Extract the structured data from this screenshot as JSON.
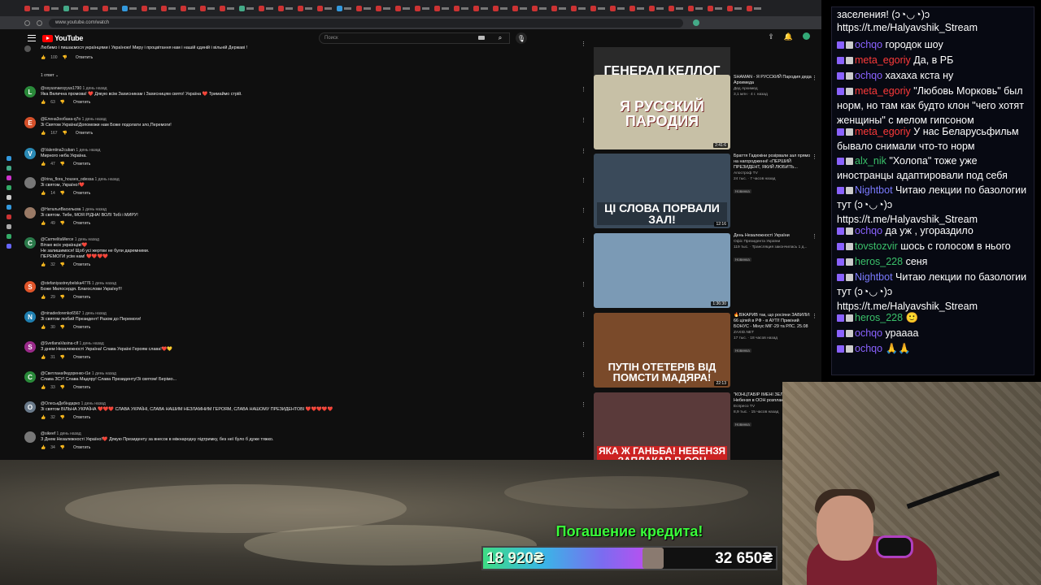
{
  "browser": {
    "url": "www.youtube.com/watch",
    "tab_colors": [
      "#c33",
      "#c33",
      "#4a8",
      "#c33",
      "#c33",
      "#39d",
      "#c33",
      "#c33",
      "#c33",
      "#c33",
      "#c33",
      "#4a8",
      "#c33",
      "#c33",
      "#c33",
      "#c33",
      "#39d",
      "#c33",
      "#c33",
      "#c33",
      "#c33",
      "#c33",
      "#c33",
      "#c33",
      "#c33",
      "#c33",
      "#c33",
      "#c33",
      "#c33",
      "#c33",
      "#c33",
      "#c33",
      "#c33",
      "#c33",
      "#c33",
      "#c33",
      "#c33",
      "#c33"
    ]
  },
  "youtube": {
    "logo": "YouTube",
    "search_placeholder": "Поиск"
  },
  "comments": [
    {
      "avatar": "",
      "avatar_color": "#555",
      "author": "",
      "time": "",
      "text": "Любимо і пишаємося українцями і Україною! Миру і процвітання нам і нашій єдиній і вільній Державі !",
      "likes": "100",
      "reply": "Ответить",
      "replies": "1 ответ"
    },
    {
      "avatar": "L",
      "avatar_color": "#2a8a3a",
      "author": "@ssyusnaesyyus1790",
      "time": "1 день назад",
      "text": "Яка Велична промова! ❤️ Дякую всім Захисникам і Захисницям свято! Україна ❤️ Тримаймо стрій.",
      "likes": "63",
      "reply": "Ответить"
    },
    {
      "avatar": "E",
      "avatar_color": "#d5502a",
      "author": "@Елена3ooбaнa-q7o",
      "time": "1 день назад",
      "text": "Зі Святом Україна!Допоможи нам Боже подолати зло,Перемоги!",
      "likes": "167",
      "reply": "Ответить"
    },
    {
      "avatar": "V",
      "avatar_color": "#2a8ab5",
      "author": "@Valentina2cuban",
      "time": "1 день назад",
      "text": "Мирного неба Україна.",
      "likes": "47",
      "reply": "Ответить"
    },
    {
      "avatar": "",
      "avatar_color": "#777",
      "author": "@Irina_flora_houses_odessa",
      "time": "1 день назад",
      "text": "Зі святом, Україно!❤️",
      "likes": "14",
      "reply": "Ответить"
    },
    {
      "avatar": "",
      "avatar_color": "#9a7a66",
      "author": "@НатальяВасильєва",
      "time": "1 день назад",
      "text": "Зі святом. Тебе, МОЯ РІДНА! ВОЛІ Тобі і МИРУ!",
      "likes": "49",
      "reply": "Ответить"
    },
    {
      "avatar": "C",
      "avatar_color": "#2a7a4a",
      "author": "@CarmelitaMerce",
      "time": "1 день назад",
      "text": "Вітаю всіх українців!❤️\nНе залишимося! Щоб усі жертви не були даремними.\nПЕРЕМОГИ усім нам! ❤️❤️❤️❤️",
      "likes": "32",
      "reply": "Ответить"
    },
    {
      "avatar": "S",
      "avatar_color": "#e0552a",
      "author": "@stefaniyastreybelska4776",
      "time": "1 день назад",
      "text": "Боже Милосердя. Благослови Україну!!!",
      "likes": "29",
      "reply": "Ответить"
    },
    {
      "avatar": "N",
      "avatar_color": "#1f7fb0",
      "author": "@ninadedorenko6567",
      "time": "1 день назад",
      "text": "Зі святом любий Президент! Разом до Перемоги!",
      "likes": "30",
      "reply": "Ответить"
    },
    {
      "avatar": "S",
      "avatar_color": "#9a2a8a",
      "author": "@SvetlanaVasina-clf",
      "time": "1 день назад",
      "text": "З днем Незалежності Україна! Слава Україні Героям слава!❤️💛",
      "likes": "31",
      "reply": "Ответить"
    },
    {
      "avatar": "C",
      "avatar_color": "#2a8a3a",
      "author": "@СветланаФедоренко-t1e",
      "time": "1 день назад",
      "text": "Слава ЗСУ! Слава Мадяру! Слава Президенту!Зі святом! Берімо...",
      "likes": "33",
      "reply": "Ответить"
    },
    {
      "avatar": "O",
      "avatar_color": "#6a7a8a",
      "author": "@ОлеськДебіндарко",
      "time": "1 день назад",
      "text": "Зі святом ВІЛЬНА УКРАЇНА ❤️❤️❤️ СЛАВА УКРАЇНІ, СЛАВА НАШИМ НЕЗЛАМНИМ ГЕРОЯМ, СЛАВА НАШОМУ ПРЕЗИДЕНТОВІ ❤️❤️❤️❤️❤️",
      "likes": "32",
      "reply": "Ответить"
    },
    {
      "avatar": "",
      "avatar_color": "#777",
      "author": "@sikeef",
      "time": "1 день назад",
      "text": "З Днем Незалежності Україно!❤️ Дякую Президенту за внесок в міжнародну підтримку, без неї було б дуже тяжко.",
      "likes": "34",
      "reply": "Ответить"
    }
  ],
  "recommendations": [
    {
      "caption": "ГЕНЕРАЛ КЕЛЛОГ",
      "duration": "34:10",
      "title": "",
      "channel": "",
      "stats": "",
      "badge": "",
      "bg": "#2a2a2a"
    },
    {
      "caption": "Я РУССКИЙ ПАРОДИЯ",
      "duration": "2:41:6",
      "title": "SHAMAN - Я РУССКИЙ Пародия деда Архимеда",
      "channel": "Дед Архимед",
      "stats": "3,1 млн · 4 г. назад",
      "badge": "",
      "bg": "#c7c0a6"
    },
    {
      "caption": "ЦІ СЛОВА ПОРВАЛИ ЗАЛ!",
      "duration": "12:16",
      "title": "Браття Гадюкіни розірвали зал прямо на нагородженні! «ПЕРШИЙ ПРЕЗИДЕНТ, ЯКИЙ ЛЮБИТЬ...",
      "channel": "Апостроф TV",
      "stats": "24 тыс. · 7 часов назад",
      "badge": "Новинка",
      "bg": "#3a4a5a"
    },
    {
      "caption": "",
      "duration": "1:36:30",
      "title": "День Незалежності України",
      "channel": "Офіс Президента України",
      "stats": "119 тыс. · Трансляция закончилась 1 д...",
      "badge": "Новинка",
      "bg": "#7b9ab5"
    },
    {
      "caption": "ПУТІН ОТЕТЕРІВ ВІД ПОМСТИ МАДЯРА!",
      "duration": "22:13",
      "title": "🔥ВЖАРИВ так, що росіяни ЗАВИЛИ: 66 цілей в РФ - в АУТІ! Прикіний БОНУС - Мінус МІГ-29 та РЛС. 25.08",
      "channel": "ZAXID.NET",
      "stats": "17 тыс. · 18 часов назад",
      "badge": "Новинка",
      "bg": "#7a4a2a"
    },
    {
      "caption": "ЯКА Ж ГАНЬБА! НЕБЕНЗЯ ЗАПЛАКАВ В ООН",
      "duration": "",
      "title": "\"КОНЦТАБІР ІМЕНІ ЗЕЛ\" Росіянин Небензя в ООН розплакався через зая",
      "channel": "Еспресо TV",
      "stats": "8,9 тыс. · 15 часов назад",
      "badge": "Новинка",
      "bg": "#5a3a3a"
    }
  ],
  "chat": [
    {
      "user": "",
      "color": "#ffffff",
      "text": "заселения! (ↄ◔◡◔)ↄ"
    },
    {
      "user": "",
      "color": "#ffffff",
      "text": "https://t.me/Halyavshik_Stream"
    },
    {
      "user": "ochqo",
      "color": "#8a62ff",
      "text": "городок шоу"
    },
    {
      "user": "meta_egoriy",
      "color": "#ff3a3a",
      "text": "Да, в РБ"
    },
    {
      "user": "ochqo",
      "color": "#8a62ff",
      "text": "хахаха кста ну"
    },
    {
      "user": "meta_egoriy",
      "color": "#ff3a3a",
      "text": "\"Любовь Морковь\" был норм, но там как будто клон \"чего хотят женщины\" с мелом гипсоном"
    },
    {
      "user": "meta_egoriy",
      "color": "#ff3a3a",
      "text": "У нас Беларусьфильм бывало снимали что-то норм"
    },
    {
      "user": "alx_nik",
      "color": "#3ac06a",
      "text": "\"Холопа\" тоже уже иностранцы адаптировали под себя"
    },
    {
      "user": "Nightbot",
      "color": "#7a7aff",
      "text": "Читаю лекции по базологии тут (ↄ◔◡◔)ↄ https://t.me/Halyavshik_Stream"
    },
    {
      "user": "ochqo",
      "color": "#8a62ff",
      "text": "да уж , угораздило"
    },
    {
      "user": "tovstozvir",
      "color": "#3ac06a",
      "text": "шось с голосом в нього"
    },
    {
      "user": "heros_228",
      "color": "#3ac06a",
      "text": "сеня"
    },
    {
      "user": "Nightbot",
      "color": "#7a7aff",
      "text": "Читаю лекции по базологии тут (ↄ◔◡◔)ↄ https://t.me/Halyavshik_Stream"
    },
    {
      "user": "heros_228",
      "color": "#3ac06a",
      "text": "🙂"
    },
    {
      "user": "ochqo",
      "color": "#8a62ff",
      "text": "урааaa"
    },
    {
      "user": "ochqo",
      "color": "#8a62ff",
      "text": "🙏🙏"
    }
  ],
  "donation": {
    "title": "Погашение кредита!",
    "current": "18 920₴",
    "goal": "32 650₴",
    "progress_fraction": 0.58
  }
}
